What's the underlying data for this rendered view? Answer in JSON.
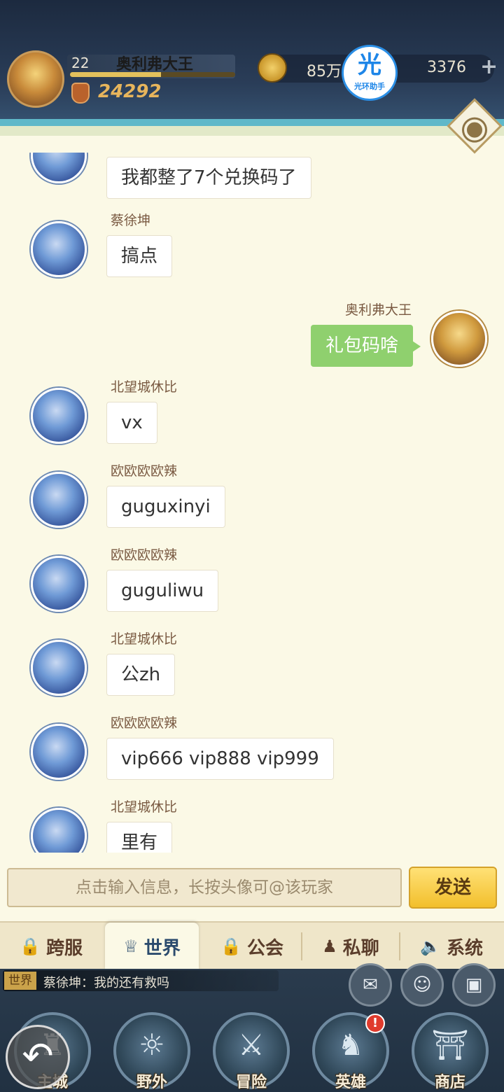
{
  "header": {
    "player_level": "22",
    "player_name": "奥利弗大王",
    "exp_fraction": 0.55,
    "power": "24292",
    "gold": "85万",
    "gems": "3376",
    "plus_icon": "+",
    "helper_glyph": "光",
    "helper_label": "光环助手"
  },
  "messages": [
    {
      "name": "",
      "text": "我都整了7个兑换码了",
      "self": false
    },
    {
      "name": "蔡徐坤",
      "text": "搞点",
      "self": false
    },
    {
      "name": "奥利弗大王",
      "text": "礼包码啥",
      "self": true
    },
    {
      "name": "北望城休比",
      "text": "vx",
      "self": false
    },
    {
      "name": "欧欧欧欧辣",
      "text": "guguxinyi",
      "self": false
    },
    {
      "name": "欧欧欧欧辣",
      "text": "guguliwu",
      "self": false
    },
    {
      "name": "北望城休比",
      "text": "公zh",
      "self": false
    },
    {
      "name": "欧欧欧欧辣",
      "text": "vip666 vip888 vip999",
      "self": false
    },
    {
      "name": "北望城休比",
      "text": "里有",
      "self": false
    }
  ],
  "input": {
    "placeholder": "点击输入信息，长按头像可@该玩家",
    "send_label": "发送"
  },
  "tabs": [
    {
      "label": "跨服",
      "icon": "lock-icon"
    },
    {
      "label": "世界",
      "icon": "world-icon"
    },
    {
      "label": "公会",
      "icon": "lock-icon"
    },
    {
      "label": "私聊",
      "icon": "people-icon"
    },
    {
      "label": "系统",
      "icon": "speaker-icon"
    }
  ],
  "active_tab": "世界",
  "ticker": {
    "tag": "世界",
    "text": "蔡徐坤：我的还有救吗"
  },
  "nav": [
    {
      "label": "主城",
      "icon": "castle-icon"
    },
    {
      "label": "野外",
      "icon": "wild-icon"
    },
    {
      "label": "冒险",
      "icon": "sword-icon"
    },
    {
      "label": "英雄",
      "icon": "helmet-icon"
    },
    {
      "label": "商店",
      "icon": "shop-icon"
    }
  ],
  "hero_badge": "!",
  "colors": {
    "panel_bg": "#fbf9e6",
    "self_bubble": "#8fd06e",
    "send_button": "#f2bf2c"
  }
}
